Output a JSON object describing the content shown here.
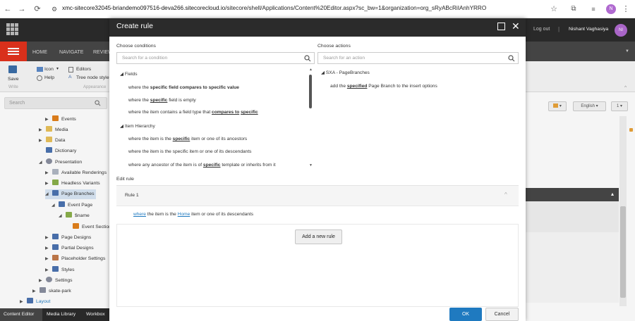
{
  "browser": {
    "url_prefix": "xmc-sitecore32045-briandemo097516-deva266.sitecorecloud.io",
    "url_path": "/sitecore/shell/Applications/Content%20Editor.aspx?sc_bw=1&organization=org_sRyABcRiIAnhYRRO",
    "profile_initial": "N"
  },
  "header": {
    "logout": "Log out",
    "separator": "|",
    "username": "Nishant Vaghasiya",
    "avatar_initials": "NI"
  },
  "ribbon": {
    "tabs": [
      "HOME",
      "NAVIGATE",
      "REVIEW"
    ],
    "save": "Save",
    "write_group": "Write",
    "icon": "Icon",
    "help": "Help",
    "editors": "Editors",
    "tree_node_style": "Tree node style",
    "appearance_group": "Appearance"
  },
  "tree_search": {
    "placeholder": "Search"
  },
  "tree": [
    {
      "label": "Events",
      "arrow": "▶",
      "color": "#e2821d"
    },
    {
      "label": "Media",
      "arrow": "▶",
      "color": "#e9c15a"
    },
    {
      "label": "Data",
      "arrow": "▶",
      "color": "#e9c15a"
    },
    {
      "label": "Dictionary",
      "arrow": "",
      "color": "#4b73b0"
    },
    {
      "label": "Presentation",
      "arrow": "◢",
      "color": "#8a8fa0"
    },
    {
      "label": "Available Renderings",
      "arrow": "▶",
      "color": "#b0b8c4"
    },
    {
      "label": "Headless Variants",
      "arrow": "▶",
      "color": "#8bb04b"
    },
    {
      "label": "Page Branches",
      "arrow": "◢",
      "color": "#4b73b0"
    },
    {
      "label": "Event Page",
      "arrow": "◢",
      "color": "#4b73b0"
    },
    {
      "label": "$name",
      "arrow": "◢",
      "color": "#8bb04b"
    },
    {
      "label": "Event Section",
      "arrow": "",
      "color": "#e2821d"
    },
    {
      "label": "Page Designs",
      "arrow": "▶",
      "color": "#4b73b0"
    },
    {
      "label": "Partial Designs",
      "arrow": "▶",
      "color": "#4b73b0"
    },
    {
      "label": "Placeholder Settings",
      "arrow": "▶",
      "color": "#c27a4b"
    },
    {
      "label": "Styles",
      "arrow": "▶",
      "color": "#4b73b0"
    },
    {
      "label": "Settings",
      "arrow": "▶",
      "color": "#8a8fa0"
    },
    {
      "label": "skate-park",
      "arrow": "▶",
      "color": "#8a8fa0"
    },
    {
      "label": "Layout",
      "arrow": "▶",
      "color": "#4b73b0"
    }
  ],
  "right_panel": {
    "language_button": "English",
    "version_button": "1"
  },
  "bottom_tabs": [
    "Content Editor",
    "Media Library",
    "Workbox"
  ],
  "modal": {
    "title": "Create rule",
    "choose_conditions": "Choose conditions",
    "conditions_placeholder": "Search for a condition",
    "choose_actions": "Choose actions",
    "actions_placeholder": "Search for an action",
    "condition_groups": [
      {
        "name": "Fields",
        "items": [
          [
            "where the ",
            "specific field",
            " ",
            "compares to specific value",
            ""
          ],
          [
            "where the ",
            "specific",
            " field is empty",
            "",
            ""
          ],
          [
            "where the item contains a field type that ",
            "compares to",
            " ",
            "specific",
            ""
          ]
        ]
      },
      {
        "name": "Item Hierarchy",
        "items": [
          [
            "where the item is the ",
            "specific",
            " item or one of its ancestors",
            "",
            ""
          ],
          [
            "where the item is the ",
            "specific",
            " item or one of its descendants",
            "",
            ""
          ],
          [
            "where any ancestor of the item is of ",
            "specific",
            " template or inherits from it",
            "",
            ""
          ]
        ]
      }
    ],
    "action_group": "SXA - PageBranches",
    "action_item": [
      "add the ",
      "specified",
      " Page Branch to the insert options"
    ],
    "edit_rule_label": "Edit rule",
    "rule_title": "Rule 1",
    "rule_text": [
      "where",
      " the item is the ",
      "Home",
      " item or one of its descendants"
    ],
    "add_rule_button": "Add a new rule",
    "ok_button": "OK",
    "cancel_button": "Cancel"
  }
}
